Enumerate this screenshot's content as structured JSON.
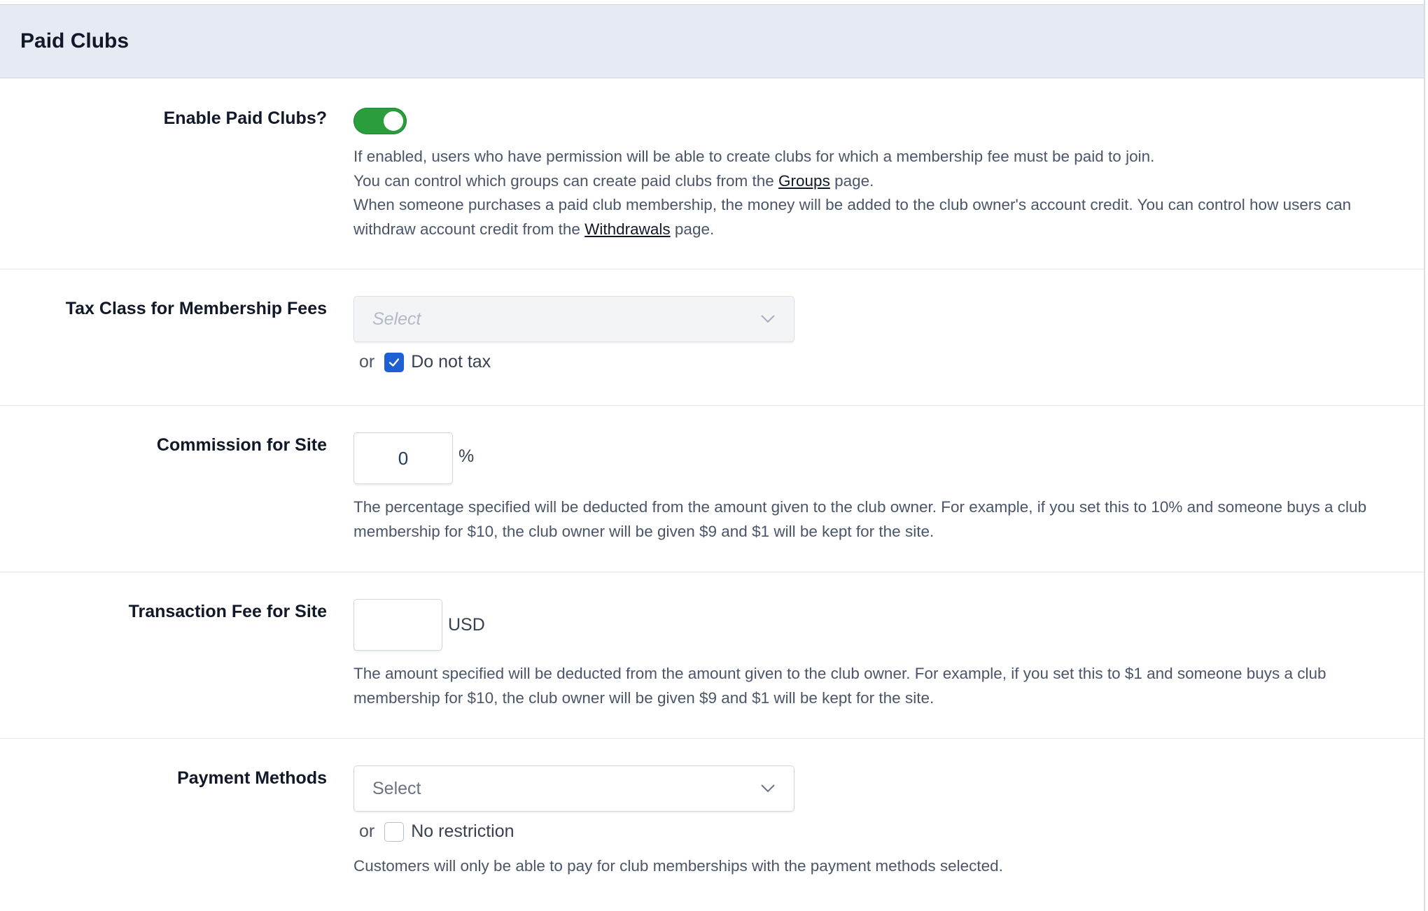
{
  "header": {
    "title": "Paid Clubs"
  },
  "enable": {
    "label": "Enable Paid Clubs?",
    "toggle_on": true,
    "desc_line1": "If enabled, users who have permission will be able to create clubs for which a membership fee must be paid to join.",
    "desc_line2_pre": "You can control which groups can create paid clubs from the ",
    "desc_line2_link": "Groups",
    "desc_line2_post": " page.",
    "desc_line3_pre": "When someone purchases a paid club membership, the money will be added to the club owner's account credit. You can control how users can withdraw account credit from the ",
    "desc_line3_link": "Withdrawals",
    "desc_line3_post": " page."
  },
  "tax": {
    "label": "Tax Class for Membership Fees",
    "select_placeholder": "Select",
    "or_text": "or",
    "checkbox_label": "Do not tax",
    "checked": true
  },
  "commission": {
    "label": "Commission for Site",
    "value": "0",
    "unit": "%",
    "desc": "The percentage specified will be deducted from the amount given to the club owner. For example, if you set this to 10% and someone buys a club membership for $10, the club owner will be given $9 and $1 will be kept for the site."
  },
  "transaction": {
    "label": "Transaction Fee for Site",
    "value": "",
    "unit": "USD",
    "desc": "The amount specified will be deducted from the amount given to the club owner. For example, if you set this to $1 and someone buys a club membership for $10, the club owner will be given $9 and $1 will be kept for the site."
  },
  "payment": {
    "label": "Payment Methods",
    "select_placeholder": "Select",
    "or_text": "or",
    "checkbox_label": "No restriction",
    "checked": false,
    "desc": "Customers will only be able to pay for club memberships with the payment methods selected."
  },
  "colors": {
    "toggle_on": "#2a9d3c",
    "checkbox_checked": "#1f5fd6",
    "header_bg": "#e6eaf2"
  }
}
